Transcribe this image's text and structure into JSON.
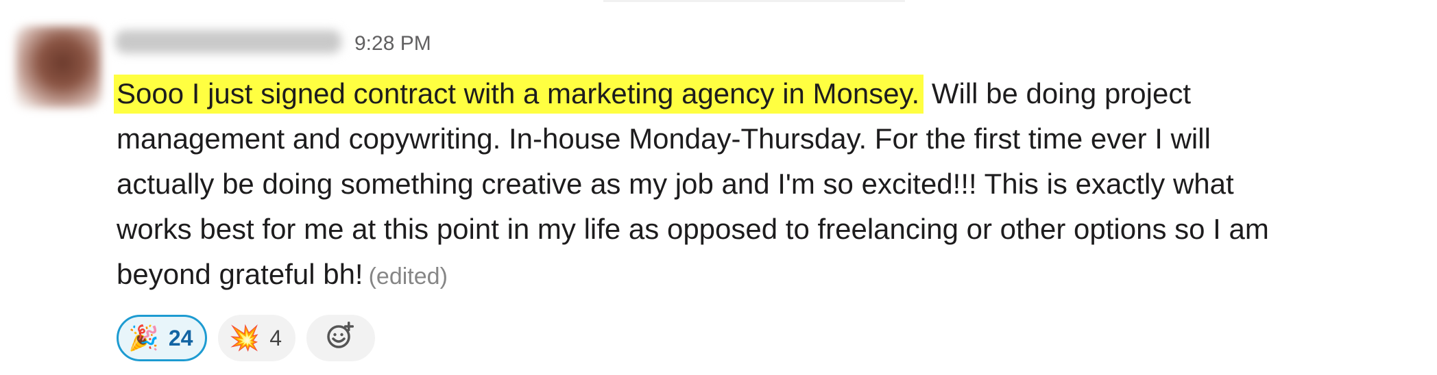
{
  "message": {
    "author": "",
    "time": "9:28 PM",
    "highlighted_text": "Sooo I just signed contract with a marketing agency in Monsey.",
    "lines": [
      " Will be doing project",
      "management and copywriting. In-house Monday-Thursday. For the first time ever I will",
      "actually be doing something creative as my job and I'm so excited!!! This is exactly what",
      "works best for me at this point in my life as opposed to freelancing or other options so I am",
      "beyond grateful bh!"
    ],
    "edited_label": "(edited)"
  },
  "reactions": [
    {
      "emoji": "🎉",
      "icon": "party-popper-icon",
      "count": "24",
      "active": true
    },
    {
      "emoji": "💥",
      "icon": "collision-icon",
      "count": "4",
      "active": false
    }
  ],
  "add_reaction": {
    "icon": "add-emoji-icon"
  },
  "colors": {
    "highlight": "#ffff41",
    "active_reaction_border": "#1d9bd1",
    "active_reaction_text": "#1264a3",
    "text": "#1d1c1d",
    "muted": "#616061"
  }
}
